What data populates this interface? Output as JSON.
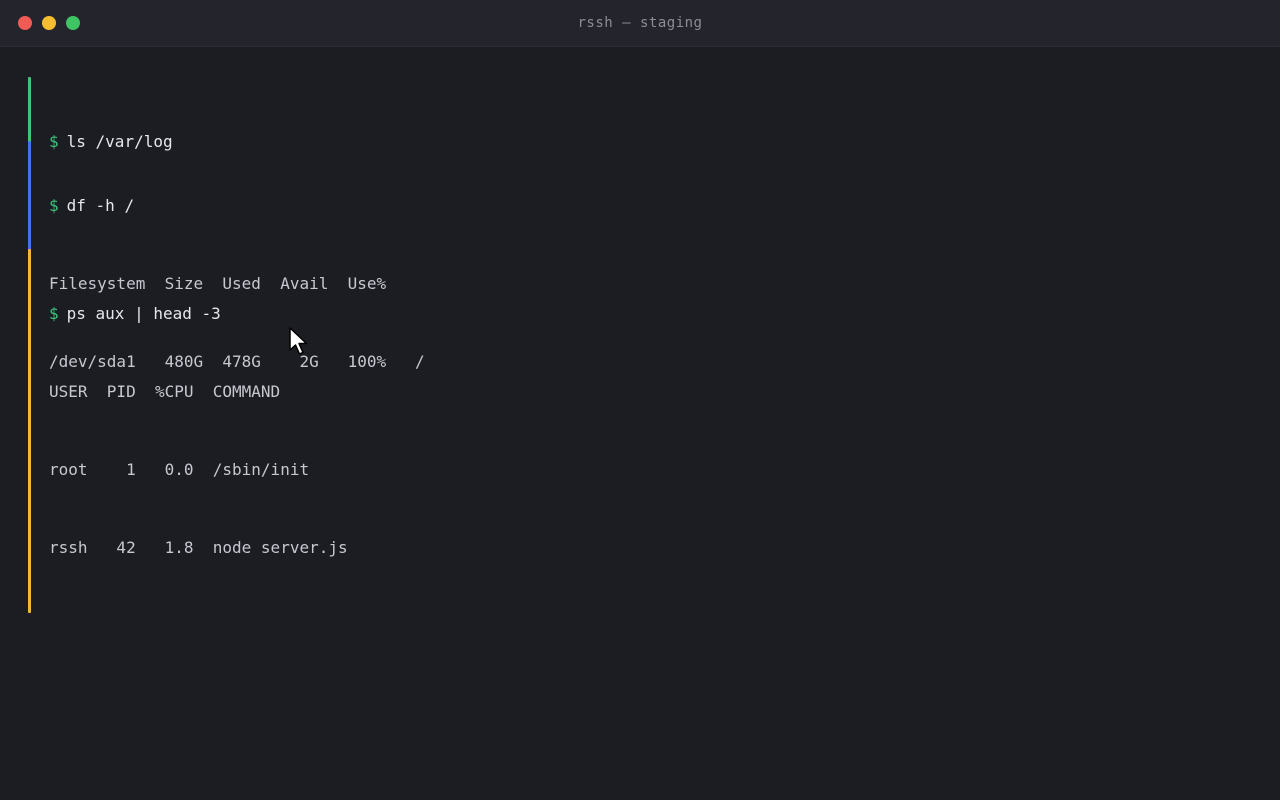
{
  "window": {
    "title": "rssh — staging"
  },
  "blocks": [
    {
      "accent": "#3fc47c",
      "prompt": "$",
      "command": "ls /var/log",
      "output": []
    },
    {
      "accent": "#4b6ef0",
      "prompt": "$",
      "command": "df -h /",
      "output": [
        "Filesystem  Size  Used  Avail  Use%",
        "/dev/sda1   480G  478G    2G   100%   /"
      ]
    },
    {
      "accent": "#f3b637",
      "prompt": "$",
      "command": "ps aux | head -3",
      "output": [
        "USER  PID  %CPU  COMMAND",
        "root    1   0.0  /sbin/init",
        "rssh   42   1.8  node server.js"
      ]
    }
  ],
  "colors": {
    "background": "#1c1d23",
    "titlebar": "#24252c",
    "prompt": "#3fc47c",
    "close": "#f05b56",
    "minimize": "#f6bd30",
    "maximize": "#3fc463"
  },
  "icons": {
    "cursor": "mouse-pointer-icon"
  }
}
